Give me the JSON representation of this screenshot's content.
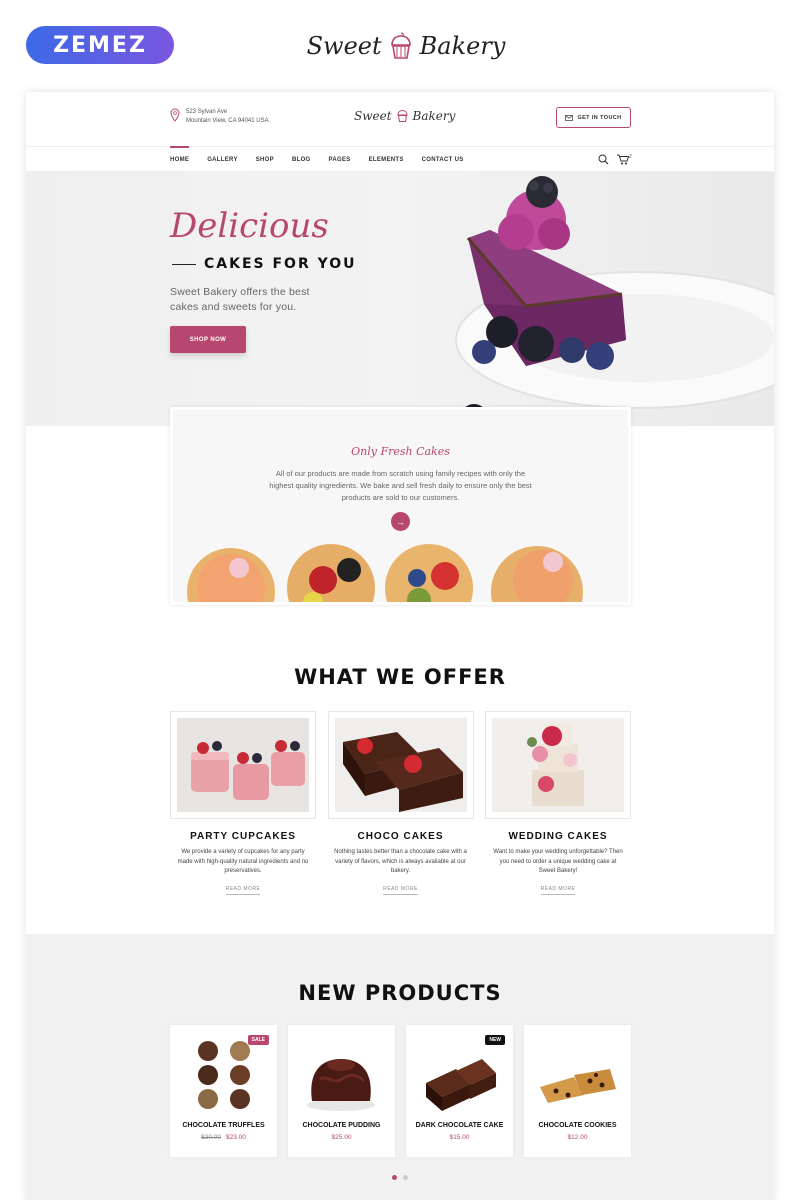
{
  "marketplace": {
    "logo_text": "ZEMEZ"
  },
  "brand": {
    "name_left": "Sweet",
    "name_right": "Bakery"
  },
  "header": {
    "address_line1": "523 Sylvan Ave",
    "address_line2": "Mountain View, CA 94041 USA",
    "get_in_touch": "GET IN TOUCH"
  },
  "nav": {
    "items": [
      "HOME",
      "GALLERY",
      "SHOP",
      "BLOG",
      "PAGES",
      "ELEMENTS",
      "CONTACT US"
    ],
    "cart_count": "2"
  },
  "hero": {
    "script_title": "Delicious",
    "title": "CAKES FOR YOU",
    "text": "Sweet Bakery offers the best cakes and sweets for you.",
    "button": "SHOP NOW"
  },
  "fresh": {
    "title": "Only Fresh Cakes",
    "text": "All of our products are made from scratch using family recipes with only the highest quality ingredients. We bake and sell fresh daily to ensure only the best products are sold to our customers."
  },
  "offer": {
    "title": "WHAT WE OFFER",
    "read_more": "READ MORE",
    "cards": [
      {
        "name": "PARTY CUPCAKES",
        "desc": "We provide a variety of cupcakes for any party made with high-quality natural ingredients and no preservatives."
      },
      {
        "name": "CHOCO CAKES",
        "desc": "Nothing tastes better than a chocolate cake with a variety of flavors, which is always available at our bakery."
      },
      {
        "name": "WEDDING CAKES",
        "desc": "Want to make your wedding unforgettable? Then you need to order a unique wedding cake at Sweet Bakery!"
      }
    ]
  },
  "products": {
    "title": "NEW PRODUCTS",
    "items": [
      {
        "name": "CHOCOLATE TRUFFLES",
        "old_price": "$30.00",
        "price": "$23.00",
        "badge": "SALE"
      },
      {
        "name": "CHOCOLATE PUDDING",
        "old_price": "",
        "price": "$25.00",
        "badge": ""
      },
      {
        "name": "DARK CHOCOLATE CAKE",
        "old_price": "",
        "price": "$15.00",
        "badge": "NEW"
      },
      {
        "name": "CHOCOLATE COOKIES",
        "old_price": "",
        "price": "$12.00",
        "badge": ""
      }
    ]
  },
  "colors": {
    "accent": "#b8476f",
    "zemez_start": "#3d6ae6",
    "zemez_end": "#7a56e0"
  }
}
